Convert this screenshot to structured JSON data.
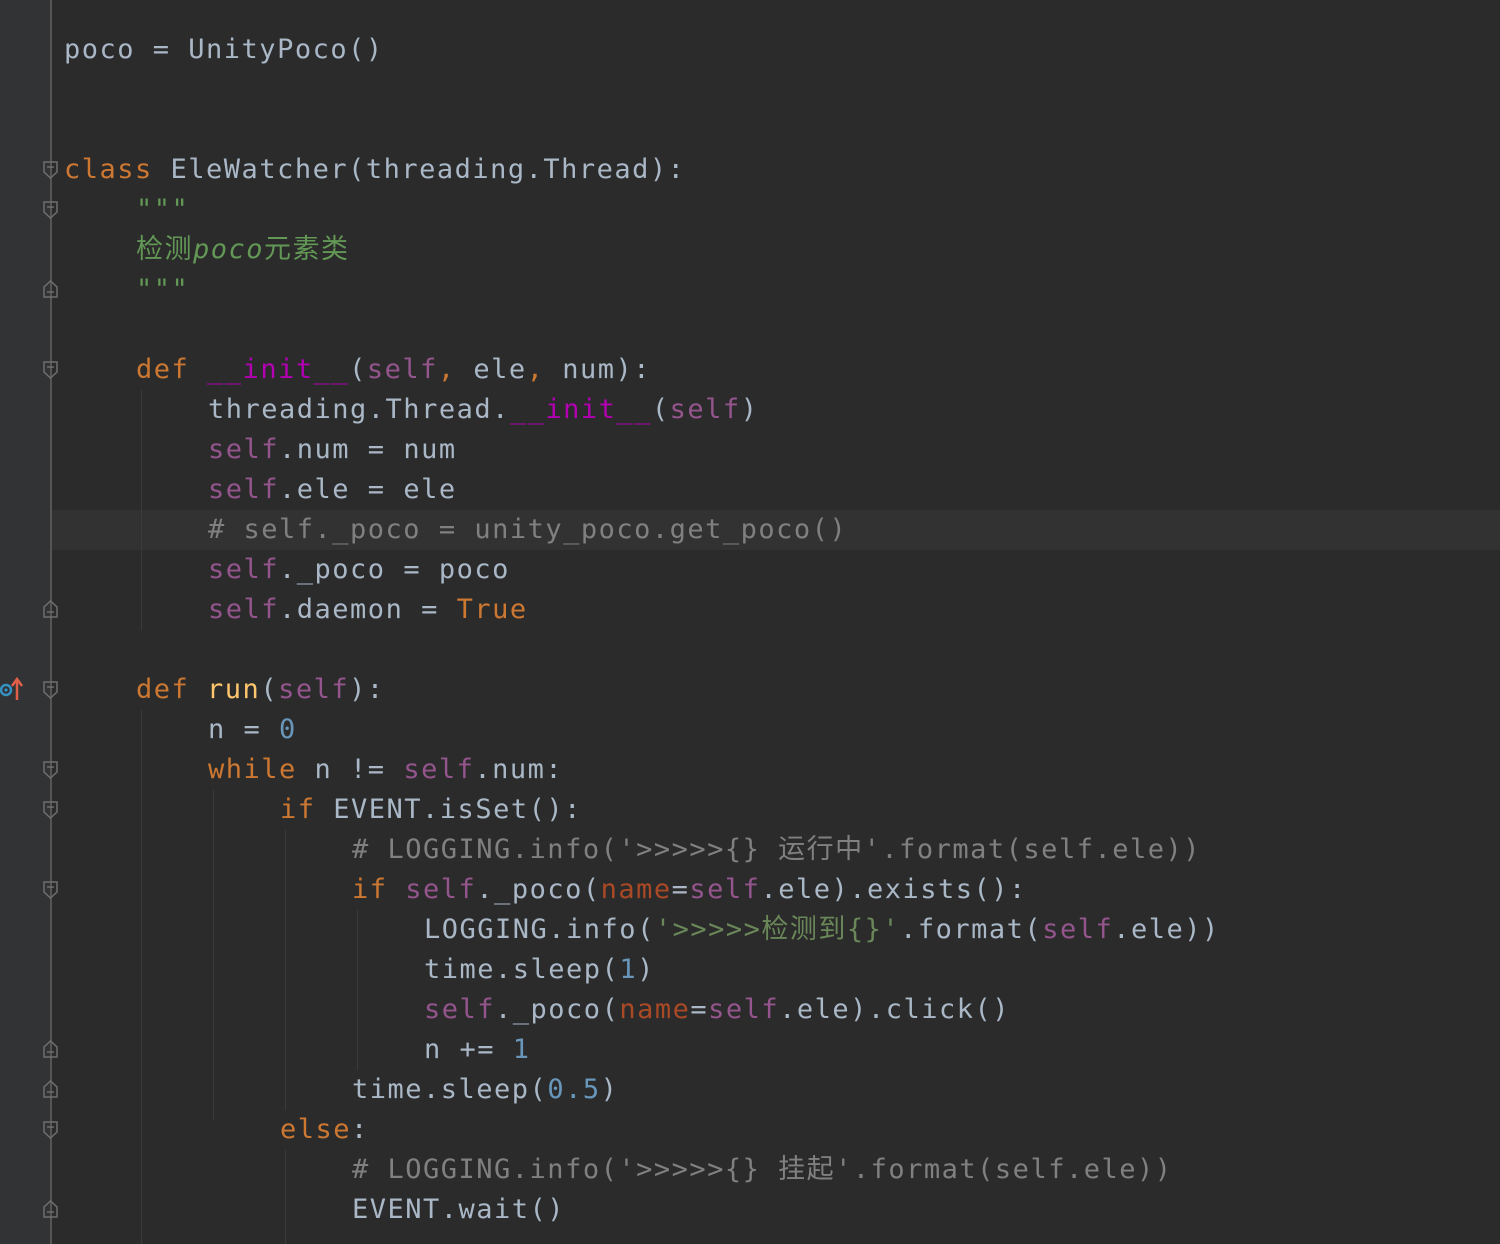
{
  "colors": {
    "background": "#2b2b2b",
    "gutter": "#313335",
    "keyword": "#cc7832",
    "self": "#94558d",
    "magic": "#b200b2",
    "number": "#6897bb",
    "string": "#6a8759",
    "docstring": "#629755",
    "comment": "#808080",
    "default": "#a9b7c6"
  },
  "code": {
    "l1": {
      "a": "poco = UnityPoco()"
    },
    "l4": {
      "a": "class",
      "b": " EleWatcher(threading.Thread):"
    },
    "l5": {
      "a": "\"\"\""
    },
    "l6": {
      "a": "检测",
      "b": "poco",
      "c": "元素类"
    },
    "l7": {
      "a": "\"\"\""
    },
    "l9": {
      "a": "def",
      "b": " ",
      "c": "__init__",
      "d": "(",
      "e": "self",
      "f": ", ",
      "g": "ele",
      "h": ", ",
      "i": "num):"
    },
    "l10": {
      "a": "threading.Thread.",
      "b": "__init__",
      "c": "(",
      "d": "self",
      "e": ")"
    },
    "l11": {
      "a": "self",
      "b": ".num = num"
    },
    "l12": {
      "a": "self",
      "b": ".ele = ele"
    },
    "l13": {
      "a": "# self._poco = unity_poco.get_poco()"
    },
    "l14": {
      "a": "self",
      "b": "._poco = poco"
    },
    "l15": {
      "a": "self",
      "b": ".daemon = ",
      "c": "True"
    },
    "l17": {
      "a": "def",
      "b": " ",
      "c": "run",
      "d": "(",
      "e": "self",
      "f": "):"
    },
    "l18": {
      "a": "n = ",
      "b": "0"
    },
    "l19": {
      "a": "while",
      "b": " n != ",
      "c": "self",
      "d": ".num:"
    },
    "l20": {
      "a": "if",
      "b": " EVENT.isSet():"
    },
    "l21": {
      "a": "# LOGGING.info('>>>>>{} 运行中'.format(self.ele))"
    },
    "l22": {
      "a": "if",
      "b": " ",
      "c": "self",
      "d": "._poco(",
      "e": "name",
      "f": "=",
      "g": "self",
      "h": ".ele).exists():"
    },
    "l23": {
      "a": "LOGGING.info(",
      "b": "'>>>>>检测到{}'",
      "c": ".format(",
      "d": "self",
      "e": ".ele))"
    },
    "l24": {
      "a": "time.sleep(",
      "b": "1",
      "c": ")"
    },
    "l25": {
      "a": "self",
      "b": "._poco(",
      "c": "name",
      "d": "=",
      "e": "self",
      "f": ".ele).click()"
    },
    "l26": {
      "a": "n += ",
      "b": "1"
    },
    "l27": {
      "a": "time.sleep(",
      "b": "0.5",
      "c": ")"
    },
    "l28": {
      "a": "else",
      "b": ":"
    },
    "l29": {
      "a": "# LOGGING.info('>>>>>{} 挂起'.format(self.ele))"
    },
    "l30": {
      "a": "EVENT.wait()"
    }
  }
}
